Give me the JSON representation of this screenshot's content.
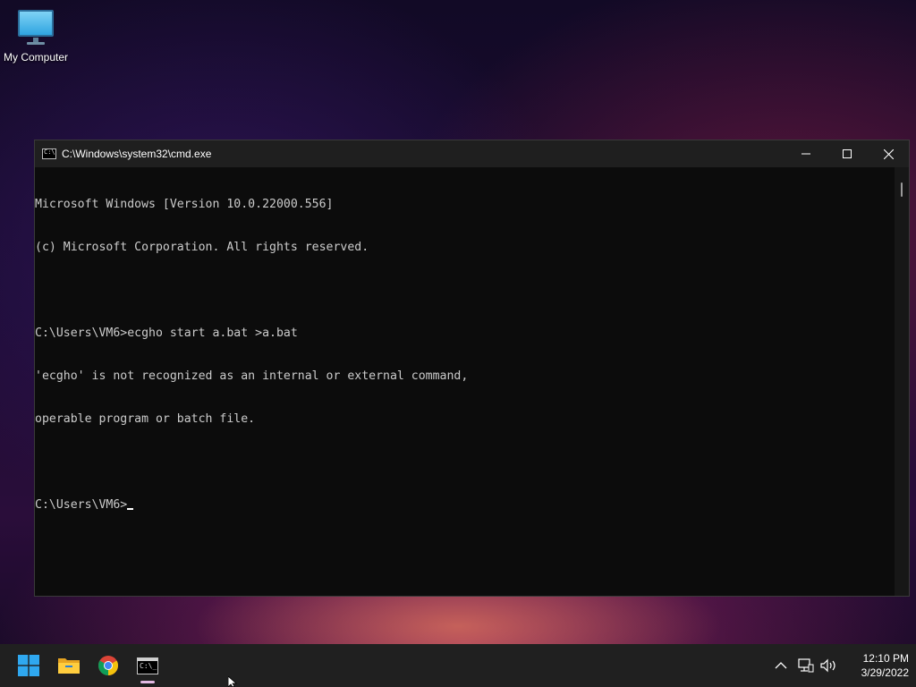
{
  "desktop": {
    "icons": [
      {
        "label": "My Computer",
        "icon": "monitor-icon"
      }
    ]
  },
  "window": {
    "title": "C:\\Windows\\system32\\cmd.exe",
    "app_icon": "cmd-icon",
    "controls": {
      "minimize": "minimize-icon",
      "maximize": "maximize-icon",
      "close": "close-icon"
    },
    "console_lines": [
      "Microsoft Windows [Version 10.0.22000.556]",
      "(c) Microsoft Corporation. All rights reserved.",
      "",
      "C:\\Users\\VM6>ecgho start a.bat >a.bat",
      "'ecgho' is not recognized as an internal or external command,",
      "operable program or batch file.",
      "",
      "C:\\Users\\VM6>"
    ]
  },
  "taskbar": {
    "pinned": [
      {
        "name": "start",
        "icon": "windows-logo-icon"
      },
      {
        "name": "file-explorer",
        "icon": "folder-icon"
      },
      {
        "name": "chrome",
        "icon": "chrome-icon"
      },
      {
        "name": "terminal",
        "icon": "terminal-icon",
        "active": true
      }
    ],
    "tray": {
      "icons": [
        "chevron-up-icon",
        "network-icon",
        "volume-icon"
      ],
      "time": "12:10 PM",
      "date": "3/29/2022"
    }
  }
}
